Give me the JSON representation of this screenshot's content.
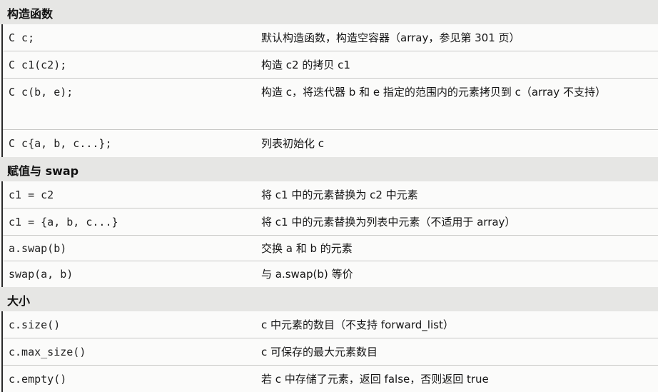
{
  "sections": [
    {
      "heading": "构造函数",
      "rows": [
        {
          "code": "C c;",
          "desc": "默认构造函数，构造空容器（array，参见第 301 页）"
        },
        {
          "code": "C c1(c2);",
          "desc": "构造 c2 的拷贝 c1"
        },
        {
          "code": "C c(b, e);",
          "desc": "构造 c，将迭代器 b 和 e 指定的范围内的元素拷贝到 c（array 不支持）"
        },
        {
          "code": "C c{a, b, c...};",
          "desc": "列表初始化 c"
        }
      ]
    },
    {
      "heading": "赋值与 swap",
      "rows": [
        {
          "code": "c1 = c2",
          "desc": "将 c1 中的元素替换为 c2 中元素"
        },
        {
          "code": "c1 = {a, b, c...}",
          "desc": "将 c1 中的元素替换为列表中元素（不适用于 array）"
        },
        {
          "code": "a.swap(b)",
          "desc": "交换 a 和 b 的元素"
        },
        {
          "code": "swap(a, b)",
          "desc": "与 a.swap(b) 等价"
        }
      ]
    },
    {
      "heading": "大小",
      "rows": [
        {
          "code": "c.size()",
          "desc": "c 中元素的数目（不支持 forward_list）"
        },
        {
          "code": "c.max_size()",
          "desc": "c 可保存的最大元素数目"
        },
        {
          "code": "c.empty()",
          "desc": "若 c 中存储了元素，返回 false，否则返回 true"
        }
      ]
    }
  ]
}
